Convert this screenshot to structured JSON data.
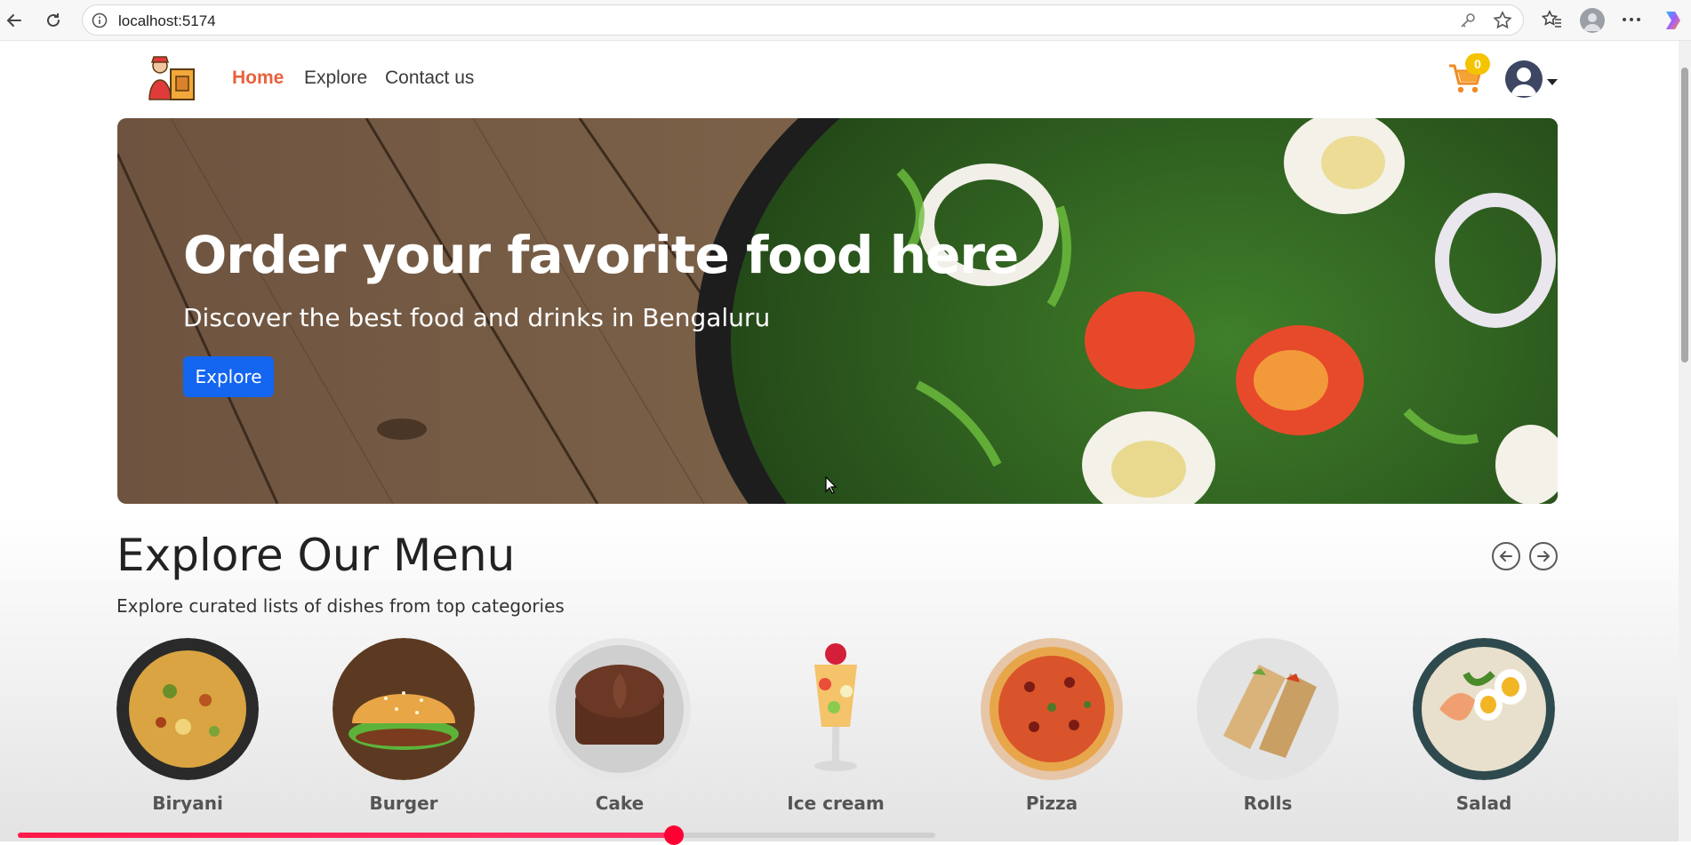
{
  "browser": {
    "url": "localhost:5174",
    "icons": [
      "back-icon",
      "reload-icon",
      "info-icon",
      "key-icon",
      "star-icon",
      "favorites-icon",
      "profile-icon",
      "more-icon",
      "copilot-icon"
    ]
  },
  "navbar": {
    "links": [
      {
        "label": "Home",
        "active": true
      },
      {
        "label": "Explore",
        "active": false
      },
      {
        "label": "Contact us",
        "active": false
      }
    ],
    "cart_count": "0",
    "accent_color": "#e8613d"
  },
  "hero": {
    "title": "Order your favorite food here",
    "subtitle": "Discover the best food and drinks in Bengaluru",
    "button_label": "Explore",
    "button_color": "#1465f0"
  },
  "menu": {
    "title": "Explore Our Menu",
    "subtitle": "Explore curated lists of dishes from top categories",
    "categories": [
      {
        "label": "Biryani"
      },
      {
        "label": "Burger"
      },
      {
        "label": "Cake"
      },
      {
        "label": "Ice cream"
      },
      {
        "label": "Pizza"
      },
      {
        "label": "Rolls"
      },
      {
        "label": "Salad"
      }
    ]
  },
  "video": {
    "progress": 0.715
  }
}
